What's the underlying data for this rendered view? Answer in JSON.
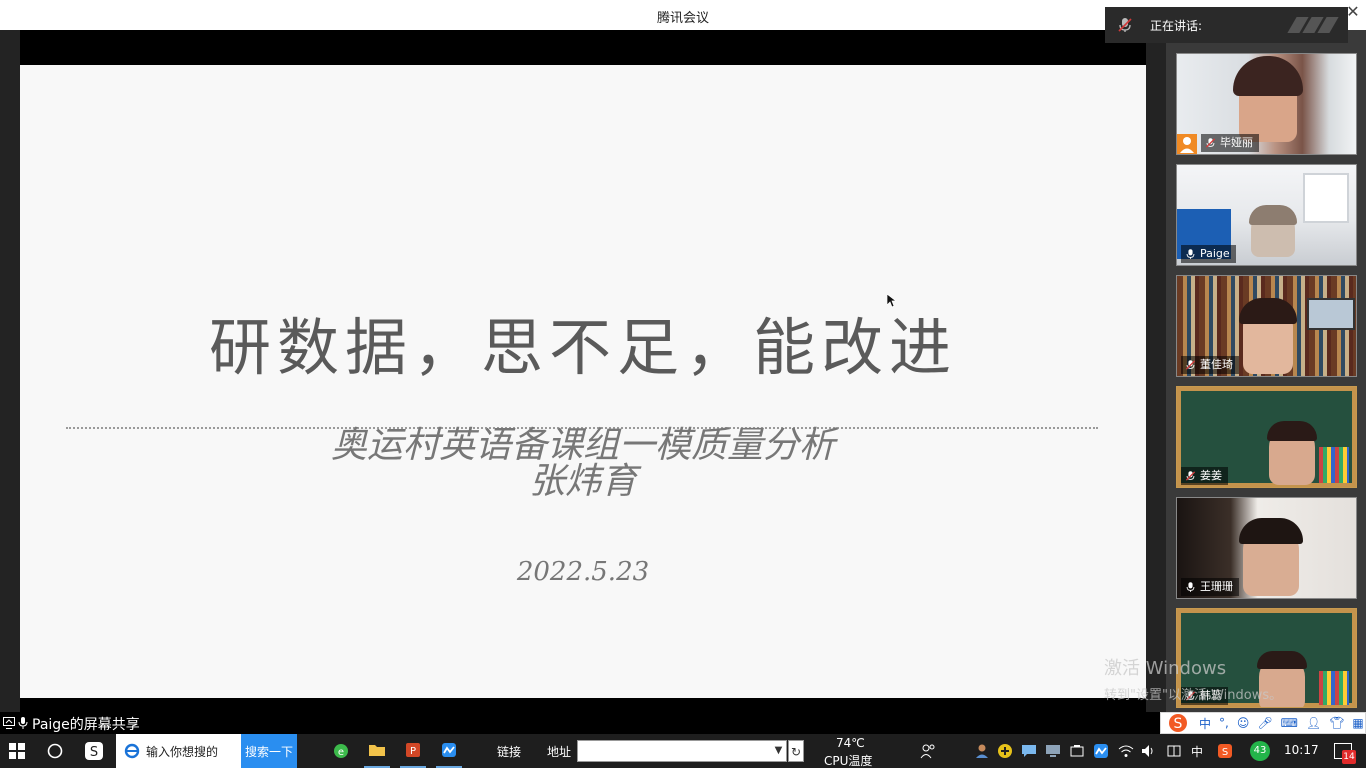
{
  "window": {
    "title": "腾讯会议"
  },
  "slide": {
    "title": "研数据，思不足，能改进",
    "subtitle_line1": "奥运村英语备课组一模质量分析",
    "subtitle_line2": "张炜育",
    "date": "2022.5.23"
  },
  "speaking": {
    "label": "正在讲话:"
  },
  "participants": [
    {
      "name": "毕娅丽",
      "mic": "muted"
    },
    {
      "name": "Paige",
      "mic": "on"
    },
    {
      "name": "董佳琦",
      "mic": "muted"
    },
    {
      "name": "姜姜",
      "mic": "muted"
    },
    {
      "name": "王珊珊",
      "mic": "on"
    },
    {
      "name": "韩蕊",
      "mic": "muted"
    }
  ],
  "share_bar": {
    "label": "Paige的屏幕共享"
  },
  "watermark": {
    "line1": "激活 Windows",
    "line2": "转到\"设置\"以激活 Windows。"
  },
  "taskbar": {
    "search_placeholder": "输入你想搜的",
    "search_button": "搜索一下",
    "links_label": "链接",
    "address_label": "地址",
    "cpu_temp": "74℃",
    "cpu_label": "CPU温度",
    "badge_count": "43",
    "time": "10:17",
    "notification_count": "14"
  },
  "ime": {
    "mode": "中"
  },
  "colors": {
    "accent": "#2a8ef0",
    "slide_bg": "#f8f8f8",
    "mute_red": "#d33a3a"
  }
}
